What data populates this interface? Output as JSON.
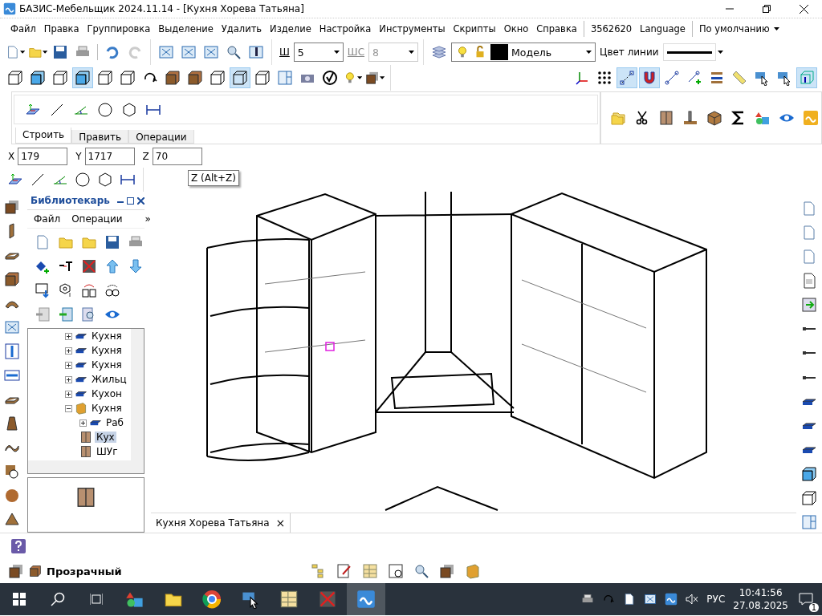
{
  "window": {
    "title": "БАЗИС-Мебельщик 2024.11.14 - [Кухня Хорева Татьяна]"
  },
  "menu": [
    "Файл",
    "Правка",
    "Группировка",
    "Выделение",
    "Удалить",
    "Изделие",
    "Настройка",
    "Инструменты",
    "Скрипты",
    "Окно",
    "Справка"
  ],
  "menu_extras": [
    "3562620",
    "Language"
  ],
  "profile": {
    "value": "По умолчанию"
  },
  "line_width": {
    "label": "Ш",
    "value": "5"
  },
  "line_style": {
    "label": "ШС",
    "value": "8",
    "disabled": true
  },
  "layer": {
    "value": "Модель"
  },
  "line_color": {
    "label": "Цвет линии"
  },
  "view_toolbar": [
    {
      "selected": false
    },
    {
      "selected": false
    },
    {
      "selected": false
    },
    {
      "selected": true
    },
    {
      "selected": false
    },
    {
      "selected": false
    },
    {
      "selected": false
    },
    {
      "selected": false
    },
    {
      "selected": false
    },
    {
      "selected": false
    },
    {
      "selected": true
    },
    {
      "selected": false
    },
    {
      "selected": false
    }
  ],
  "snap_toolbar": [
    {
      "selected": false
    },
    {
      "selected": false
    },
    {
      "selected": true
    },
    {
      "selected": true
    },
    {
      "selected": false
    },
    {
      "selected": false
    },
    {
      "selected": false
    },
    {
      "selected": false
    },
    {
      "selected": false
    },
    {
      "selected": false
    },
    {
      "selected": true
    }
  ],
  "build_tabs": [
    {
      "label": "Строить",
      "selected": true
    },
    {
      "label": "Править",
      "selected": false
    },
    {
      "label": "Операции",
      "selected": false
    }
  ],
  "coordinates": [
    {
      "label": "X",
      "value": "179"
    },
    {
      "label": "Y",
      "value": "1717"
    },
    {
      "label": "Z",
      "value": "70"
    }
  ],
  "tooltip": "Z (Alt+Z)",
  "library": {
    "title": "Библиотекарь",
    "menu": [
      "Файл",
      "Операции"
    ],
    "more": "»",
    "tree": [
      {
        "label": "Кухня",
        "expanded": false
      },
      {
        "label": "Кухня",
        "expanded": false
      },
      {
        "label": "Кухня",
        "expanded": false
      },
      {
        "label": "Жильц",
        "expanded": false
      },
      {
        "label": "Кухон",
        "expanded": false
      },
      {
        "label": "Кухня",
        "expanded": true,
        "children": [
          {
            "label": "Раб",
            "expanded": false
          },
          {
            "label": "Кух",
            "selected": true
          },
          {
            "label": "ШУг",
            "selected": false
          }
        ]
      }
    ]
  },
  "document_tabs": [
    {
      "label": "Кухня Хорева Татьяна",
      "close": "×"
    }
  ],
  "material": {
    "label": "Прозрачный"
  },
  "taskbar": {
    "language": "РУС",
    "time": "10:41:56",
    "date": "27.08.2025",
    "notifications": "1"
  }
}
